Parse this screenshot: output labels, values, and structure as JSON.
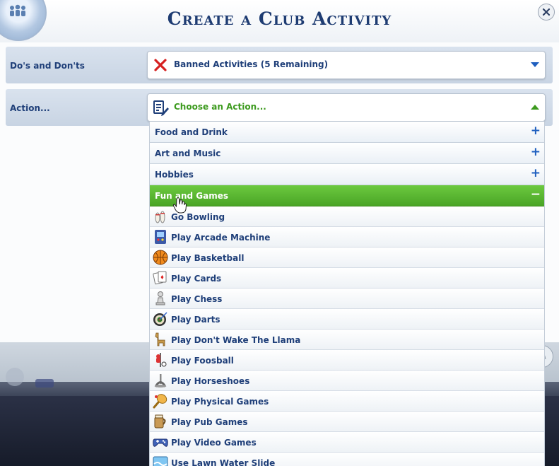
{
  "dialog": {
    "title": "Create a Club Activity"
  },
  "dos_donts": {
    "label": "Do's and Don'ts",
    "value": "Banned Activities (5 Remaining)"
  },
  "action": {
    "label": "Action...",
    "value": "Choose an Action..."
  },
  "categories": [
    {
      "label": "Food and Drink",
      "sign": "+"
    },
    {
      "label": "Art and Music",
      "sign": "+"
    },
    {
      "label": "Hobbies",
      "sign": "+"
    },
    {
      "label": "Fun and Games",
      "sign": "−"
    }
  ],
  "items": [
    {
      "label": "Go Bowling",
      "icon": "bowling-pins-icon"
    },
    {
      "label": "Play Arcade Machine",
      "icon": "arcade-machine-icon"
    },
    {
      "label": "Play Basketball",
      "icon": "basketball-icon"
    },
    {
      "label": "Play Cards",
      "icon": "playing-cards-icon"
    },
    {
      "label": "Play Chess",
      "icon": "chess-pawn-icon"
    },
    {
      "label": "Play Darts",
      "icon": "dartboard-icon"
    },
    {
      "label": "Play Don't Wake The Llama",
      "icon": "llama-icon"
    },
    {
      "label": "Play Foosball",
      "icon": "foosball-icon"
    },
    {
      "label": "Play Horseshoes",
      "icon": "horseshoe-icon"
    },
    {
      "label": "Play Physical Games",
      "icon": "paddle-ball-icon"
    },
    {
      "label": "Play Pub Games",
      "icon": "pub-games-icon"
    },
    {
      "label": "Play Video Games",
      "icon": "game-controller-icon"
    },
    {
      "label": "Use Lawn Water Slide",
      "icon": "water-slide-icon"
    }
  ],
  "colors": {
    "accent_green": "#4aa526",
    "title_blue": "#1e3c72",
    "ban_red": "#d62020"
  }
}
